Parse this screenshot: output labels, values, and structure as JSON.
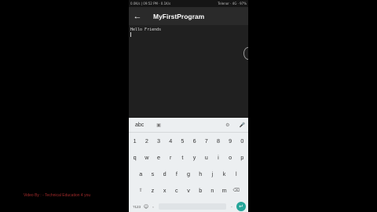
{
  "status_bar": {
    "left": "0.0K/s | 09:52 PM  ·  0.1K/s",
    "right": "Telenor  ·  4G  ·  97%"
  },
  "app_bar": {
    "back_icon": "arrow-back-icon",
    "title": "MyFirstProgram"
  },
  "editor": {
    "text": "Hello Friends"
  },
  "keyboard": {
    "mode_label": "abc",
    "toolbar_icons": [
      "keyboard-settings-icon",
      "gif-icon",
      "mic-icon"
    ],
    "rows": [
      [
        "1",
        "2",
        "3",
        "4",
        "5",
        "6",
        "7",
        "8",
        "9",
        "0"
      ],
      [
        "q",
        "w",
        "e",
        "r",
        "t",
        "y",
        "u",
        "i",
        "o",
        "p"
      ],
      [
        "a",
        "s",
        "d",
        "f",
        "g",
        "h",
        "j",
        "k",
        "l"
      ],
      [
        "⇧",
        "z",
        "x",
        "c",
        "v",
        "b",
        "n",
        "m",
        "⌫"
      ]
    ],
    "bottom": {
      "mode": "?123",
      "comma": ",",
      "period": ".",
      "enter_icon": "enter-icon"
    }
  },
  "watermark": "Video By : - Technical Education 4 you"
}
